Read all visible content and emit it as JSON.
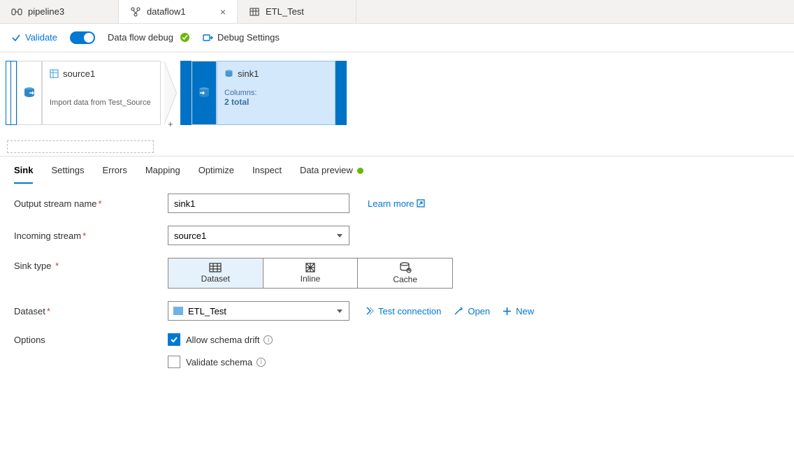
{
  "tabs": [
    {
      "label": "pipeline3",
      "icon": "pipeline"
    },
    {
      "label": "dataflow1",
      "icon": "dataflow",
      "active": true,
      "closable": true
    },
    {
      "label": "ETL_Test",
      "icon": "dataset"
    }
  ],
  "toolbar": {
    "validate": "Validate",
    "debug_label": "Data flow debug",
    "debug_settings": "Debug Settings"
  },
  "canvas": {
    "source": {
      "name": "source1",
      "sub": "Import data from Test_Source"
    },
    "sink": {
      "name": "sink1",
      "col_label": "Columns:",
      "col_value": "2 total"
    }
  },
  "subtabs": [
    "Sink",
    "Settings",
    "Errors",
    "Mapping",
    "Optimize",
    "Inspect",
    "Data preview"
  ],
  "form": {
    "output_label": "Output stream name",
    "output_value": "sink1",
    "learn_more": "Learn more",
    "incoming_label": "Incoming stream",
    "incoming_value": "source1",
    "sinktype_label": "Sink type",
    "sinktype_options": [
      "Dataset",
      "Inline",
      "Cache"
    ],
    "dataset_label": "Dataset",
    "dataset_value": "ETL_Test",
    "test_conn": "Test connection",
    "open": "Open",
    "new": "New",
    "options_label": "Options",
    "allow_drift": "Allow schema drift",
    "validate_schema": "Validate schema"
  }
}
